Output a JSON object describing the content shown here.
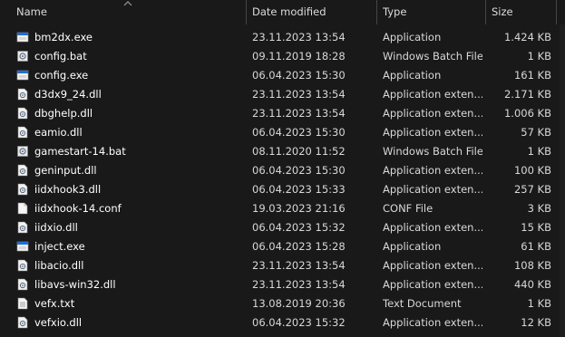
{
  "columns": {
    "name": "Name",
    "date": "Date modified",
    "type": "Type",
    "size": "Size"
  },
  "files": [
    {
      "name": "bm2dx.exe",
      "date": "23.11.2023 13:54",
      "type": "Application",
      "size": "1.424 KB",
      "icon": "exe"
    },
    {
      "name": "config.bat",
      "date": "09.11.2019 18:28",
      "type": "Windows Batch File",
      "size": "1 KB",
      "icon": "bat"
    },
    {
      "name": "config.exe",
      "date": "06.04.2023 15:30",
      "type": "Application",
      "size": "161 KB",
      "icon": "exe"
    },
    {
      "name": "d3dx9_24.dll",
      "date": "23.11.2023 13:54",
      "type": "Application exten...",
      "size": "2.171 KB",
      "icon": "dll"
    },
    {
      "name": "dbghelp.dll",
      "date": "23.11.2023 13:54",
      "type": "Application exten...",
      "size": "1.006 KB",
      "icon": "dll"
    },
    {
      "name": "eamio.dll",
      "date": "06.04.2023 15:30",
      "type": "Application exten...",
      "size": "57 KB",
      "icon": "dll"
    },
    {
      "name": "gamestart-14.bat",
      "date": "08.11.2020 11:52",
      "type": "Windows Batch File",
      "size": "1 KB",
      "icon": "bat"
    },
    {
      "name": "geninput.dll",
      "date": "06.04.2023 15:30",
      "type": "Application exten...",
      "size": "100 KB",
      "icon": "dll"
    },
    {
      "name": "iidxhook3.dll",
      "date": "06.04.2023 15:33",
      "type": "Application exten...",
      "size": "257 KB",
      "icon": "dll"
    },
    {
      "name": "iidxhook-14.conf",
      "date": "19.03.2023 21:16",
      "type": "CONF File",
      "size": "3 KB",
      "icon": "file"
    },
    {
      "name": "iidxio.dll",
      "date": "06.04.2023 15:32",
      "type": "Application exten...",
      "size": "15 KB",
      "icon": "dll"
    },
    {
      "name": "inject.exe",
      "date": "06.04.2023 15:28",
      "type": "Application",
      "size": "61 KB",
      "icon": "exe"
    },
    {
      "name": "libacio.dll",
      "date": "23.11.2023 13:54",
      "type": "Application exten...",
      "size": "108 KB",
      "icon": "dll"
    },
    {
      "name": "libavs-win32.dll",
      "date": "23.11.2023 13:54",
      "type": "Application exten...",
      "size": "440 KB",
      "icon": "dll"
    },
    {
      "name": "vefx.txt",
      "date": "13.08.2019 20:36",
      "type": "Text Document",
      "size": "1 KB",
      "icon": "txt"
    },
    {
      "name": "vefxio.dll",
      "date": "06.04.2023 15:32",
      "type": "Application exten...",
      "size": "12 KB",
      "icon": "dll"
    }
  ],
  "colors": {
    "background": "#191919",
    "text": "#ffffff",
    "exe_icon_blue": "#1e6fd9"
  }
}
